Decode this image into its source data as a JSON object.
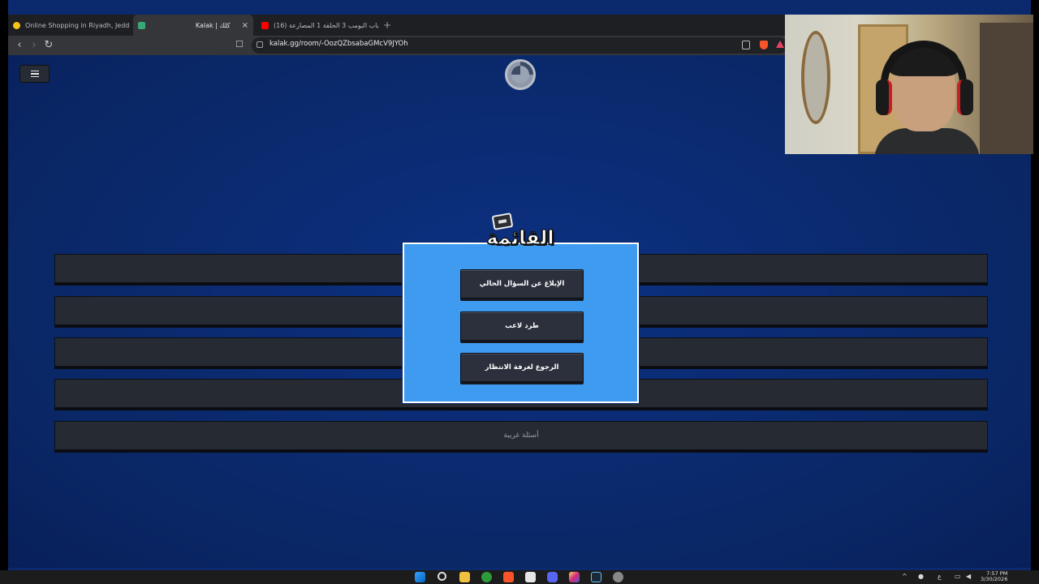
{
  "browser": {
    "tabs": [
      {
        "label": "Online Shopping in Riyadh, Jeddah a",
        "favicon_color": "#f5c518",
        "active": false
      },
      {
        "label": "Kalak | كلك",
        "favicon_color": "#3aa876",
        "active": true
      },
      {
        "label": "(16) شباب البومب 3 الحلقة 1 المصارعة",
        "favicon_color": "#ff0000",
        "active": false
      }
    ],
    "new_tab_label": "+",
    "close_label": "×",
    "url": "kalak.gg/room/-OozQZbsabaGMcV9JYOh",
    "back_label": "‹",
    "forward_label": "›",
    "reload_label": "↻",
    "bookmark_label": "☐"
  },
  "game": {
    "menu_title": "القائمة",
    "menu_buttons": [
      {
        "label": "الإبلاغ عن السؤال الحالي"
      },
      {
        "label": "طرد لاعب"
      },
      {
        "label": "الرجوع لغرفة الانتظار"
      }
    ],
    "rows": [
      {
        "label": ""
      },
      {
        "label": ""
      },
      {
        "label": ""
      },
      {
        "label": ""
      },
      {
        "label": "أسئلة غريبة"
      }
    ]
  },
  "taskbar": {
    "clock_time": "7:57 PM",
    "clock_date": "3/30/2026",
    "lang": "ع"
  },
  "colors": {
    "page_bg": "#0b2a6e",
    "modal_bg": "#3e9bf0",
    "button_bg": "#2b303c"
  }
}
